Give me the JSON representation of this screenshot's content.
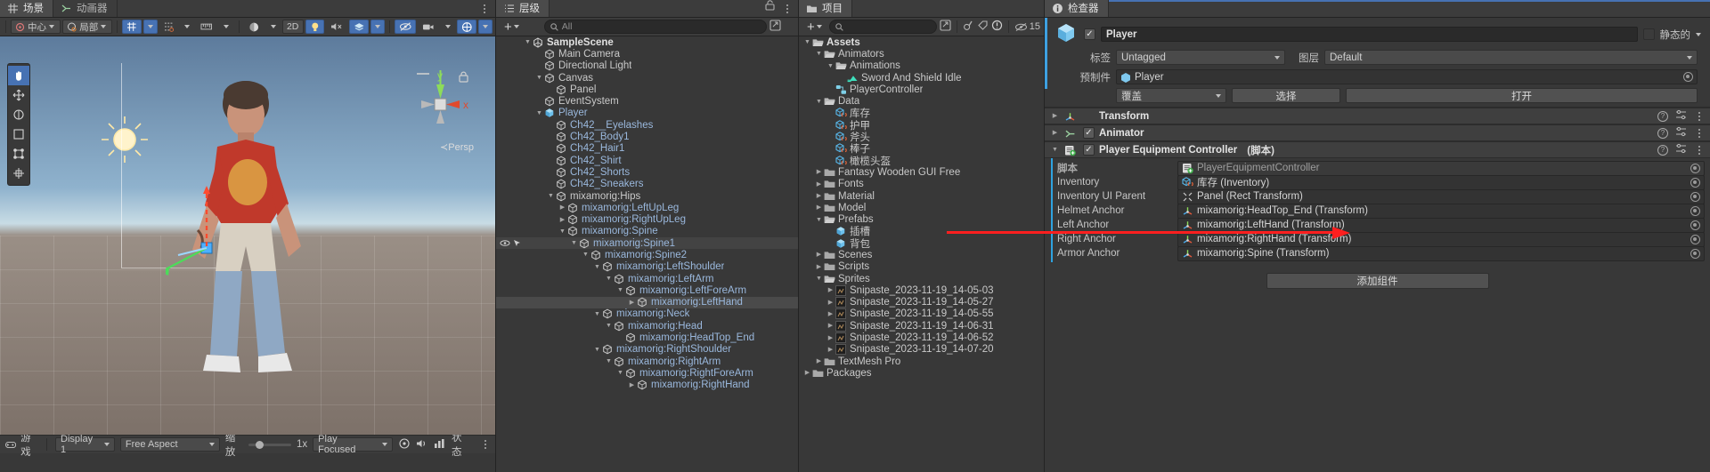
{
  "scene": {
    "tabs": [
      {
        "label": "场景",
        "icon": "grid-icon",
        "active": true
      },
      {
        "label": "动画器",
        "icon": "animator-icon",
        "active": false
      }
    ],
    "toolbar": {
      "pivot_label": "中心",
      "space_label": "局部",
      "mode_2d": "2D",
      "persp_label": "Persp",
      "axis_x": "x",
      "axis_y": "y"
    },
    "gamebar": {
      "tab_label": "游戏",
      "display": "Display 1",
      "aspect": "Free Aspect",
      "scale_label": "缩放",
      "scale_value": "1x",
      "play_focused": "Play Focused",
      "stats_label": "状态"
    }
  },
  "hierarchy": {
    "tab_label": "层级",
    "search_placeholder": "All",
    "rows": [
      {
        "label": "SampleScene",
        "depth": 0,
        "arrow": "down",
        "icon": "unity-icon",
        "style": "bold"
      },
      {
        "label": "Main Camera",
        "depth": 1,
        "arrow": "none",
        "icon": "gameobject-icon",
        "style": "normal"
      },
      {
        "label": "Directional Light",
        "depth": 1,
        "arrow": "none",
        "icon": "gameobject-icon",
        "style": "normal"
      },
      {
        "label": "Canvas",
        "depth": 1,
        "arrow": "down",
        "icon": "gameobject-icon",
        "style": "normal"
      },
      {
        "label": "Panel",
        "depth": 2,
        "arrow": "none",
        "icon": "gameobject-icon",
        "style": "normal"
      },
      {
        "label": "EventSystem",
        "depth": 1,
        "arrow": "none",
        "icon": "gameobject-icon",
        "style": "normal"
      },
      {
        "label": "Player",
        "depth": 1,
        "arrow": "down",
        "icon": "prefab-icon",
        "style": "blue"
      },
      {
        "label": "Ch42__Eyelashes",
        "depth": 2,
        "arrow": "none",
        "icon": "gameobject-icon",
        "style": "blue"
      },
      {
        "label": "Ch42_Body1",
        "depth": 2,
        "arrow": "none",
        "icon": "gameobject-icon",
        "style": "blue"
      },
      {
        "label": "Ch42_Hair1",
        "depth": 2,
        "arrow": "none",
        "icon": "gameobject-icon",
        "style": "blue"
      },
      {
        "label": "Ch42_Shirt",
        "depth": 2,
        "arrow": "none",
        "icon": "gameobject-icon",
        "style": "blue"
      },
      {
        "label": "Ch42_Shorts",
        "depth": 2,
        "arrow": "none",
        "icon": "gameobject-icon",
        "style": "blue"
      },
      {
        "label": "Ch42_Sneakers",
        "depth": 2,
        "arrow": "none",
        "icon": "gameobject-icon",
        "style": "blue"
      },
      {
        "label": "mixamorig:Hips",
        "depth": 2,
        "arrow": "down",
        "icon": "gameobject-icon",
        "style": "normal"
      },
      {
        "label": "mixamorig:LeftUpLeg",
        "depth": 3,
        "arrow": "right",
        "icon": "gameobject-icon",
        "style": "blue"
      },
      {
        "label": "mixamorig:RightUpLeg",
        "depth": 3,
        "arrow": "right",
        "icon": "gameobject-icon",
        "style": "blue"
      },
      {
        "label": "mixamorig:Spine",
        "depth": 3,
        "arrow": "down",
        "icon": "gameobject-icon",
        "style": "blue"
      },
      {
        "label": "mixamorig:Spine1",
        "depth": 4,
        "arrow": "down",
        "icon": "gameobject-icon",
        "style": "blue",
        "hover": true
      },
      {
        "label": "mixamorig:Spine2",
        "depth": 5,
        "arrow": "down",
        "icon": "gameobject-icon",
        "style": "blue"
      },
      {
        "label": "mixamorig:LeftShoulder",
        "depth": 6,
        "arrow": "down",
        "icon": "gameobject-icon",
        "style": "blue"
      },
      {
        "label": "mixamorig:LeftArm",
        "depth": 7,
        "arrow": "down",
        "icon": "gameobject-icon",
        "style": "blue"
      },
      {
        "label": "mixamorig:LeftForeArm",
        "depth": 8,
        "arrow": "down",
        "icon": "gameobject-icon",
        "style": "blue"
      },
      {
        "label": "mixamorig:LeftHand",
        "depth": 9,
        "arrow": "right",
        "icon": "gameobject-icon",
        "style": "blue",
        "selected": true
      },
      {
        "label": "mixamorig:Neck",
        "depth": 6,
        "arrow": "down",
        "icon": "gameobject-icon",
        "style": "blue"
      },
      {
        "label": "mixamorig:Head",
        "depth": 7,
        "arrow": "down",
        "icon": "gameobject-icon",
        "style": "blue"
      },
      {
        "label": "mixamorig:HeadTop_End",
        "depth": 8,
        "arrow": "none",
        "icon": "gameobject-icon",
        "style": "blue"
      },
      {
        "label": "mixamorig:RightShoulder",
        "depth": 6,
        "arrow": "down",
        "icon": "gameobject-icon",
        "style": "blue"
      },
      {
        "label": "mixamorig:RightArm",
        "depth": 7,
        "arrow": "down",
        "icon": "gameobject-icon",
        "style": "blue"
      },
      {
        "label": "mixamorig:RightForeArm",
        "depth": 8,
        "arrow": "down",
        "icon": "gameobject-icon",
        "style": "blue"
      },
      {
        "label": "mixamorig:RightHand",
        "depth": 9,
        "arrow": "right",
        "icon": "gameobject-icon",
        "style": "blue"
      }
    ]
  },
  "project": {
    "tab_label": "项目",
    "search_placeholder": "",
    "count_badge": "15",
    "rows": [
      {
        "label": "Assets",
        "depth": 0,
        "arrow": "down",
        "icon": "folder-open-icon",
        "style": "bold"
      },
      {
        "label": "Animators",
        "depth": 1,
        "arrow": "down",
        "icon": "folder-open-icon",
        "style": "normal"
      },
      {
        "label": "Animations",
        "depth": 2,
        "arrow": "down",
        "icon": "folder-open-icon",
        "style": "normal"
      },
      {
        "label": "Sword And Shield Idle",
        "depth": 3,
        "arrow": "none",
        "icon": "animation-clip-icon",
        "style": "normal"
      },
      {
        "label": "PlayerController",
        "depth": 2,
        "arrow": "none",
        "icon": "animator-controller-icon",
        "style": "normal"
      },
      {
        "label": "Data",
        "depth": 1,
        "arrow": "down",
        "icon": "folder-open-icon",
        "style": "normal"
      },
      {
        "label": "库存",
        "depth": 2,
        "arrow": "none",
        "icon": "scriptable-object-icon",
        "style": "normal"
      },
      {
        "label": "护甲",
        "depth": 2,
        "arrow": "none",
        "icon": "scriptable-object-icon",
        "style": "normal"
      },
      {
        "label": "斧头",
        "depth": 2,
        "arrow": "none",
        "icon": "scriptable-object-icon",
        "style": "normal"
      },
      {
        "label": "棒子",
        "depth": 2,
        "arrow": "none",
        "icon": "scriptable-object-icon",
        "style": "normal"
      },
      {
        "label": "橄榄头盔",
        "depth": 2,
        "arrow": "none",
        "icon": "scriptable-object-icon",
        "style": "normal"
      },
      {
        "label": "Fantasy Wooden GUI  Free",
        "depth": 1,
        "arrow": "right",
        "icon": "folder-icon",
        "style": "normal"
      },
      {
        "label": "Fonts",
        "depth": 1,
        "arrow": "right",
        "icon": "folder-icon",
        "style": "normal"
      },
      {
        "label": "Material",
        "depth": 1,
        "arrow": "right",
        "icon": "folder-icon",
        "style": "normal"
      },
      {
        "label": "Model",
        "depth": 1,
        "arrow": "right",
        "icon": "folder-icon",
        "style": "normal"
      },
      {
        "label": "Prefabs",
        "depth": 1,
        "arrow": "down",
        "icon": "folder-open-icon",
        "style": "normal"
      },
      {
        "label": "插槽",
        "depth": 2,
        "arrow": "none",
        "icon": "prefab-icon",
        "style": "normal"
      },
      {
        "label": "背包",
        "depth": 2,
        "arrow": "none",
        "icon": "prefab-icon",
        "style": "normal"
      },
      {
        "label": "Scenes",
        "depth": 1,
        "arrow": "right",
        "icon": "folder-icon",
        "style": "normal"
      },
      {
        "label": "Scripts",
        "depth": 1,
        "arrow": "right",
        "icon": "folder-icon",
        "style": "normal"
      },
      {
        "label": "Sprites",
        "depth": 1,
        "arrow": "down",
        "icon": "folder-open-icon",
        "style": "normal"
      },
      {
        "label": "Snipaste_2023-11-19_14-05-03",
        "depth": 2,
        "arrow": "right",
        "icon": "texture-icon",
        "style": "normal"
      },
      {
        "label": "Snipaste_2023-11-19_14-05-27",
        "depth": 2,
        "arrow": "right",
        "icon": "texture-icon",
        "style": "normal"
      },
      {
        "label": "Snipaste_2023-11-19_14-05-55",
        "depth": 2,
        "arrow": "right",
        "icon": "texture-icon",
        "style": "normal"
      },
      {
        "label": "Snipaste_2023-11-19_14-06-31",
        "depth": 2,
        "arrow": "right",
        "icon": "texture-icon",
        "style": "normal"
      },
      {
        "label": "Snipaste_2023-11-19_14-06-52",
        "depth": 2,
        "arrow": "right",
        "icon": "texture-icon",
        "style": "normal"
      },
      {
        "label": "Snipaste_2023-11-19_14-07-20",
        "depth": 2,
        "arrow": "right",
        "icon": "texture-icon",
        "style": "normal"
      },
      {
        "label": "TextMesh Pro",
        "depth": 1,
        "arrow": "right",
        "icon": "folder-icon",
        "style": "normal"
      },
      {
        "label": "Packages",
        "depth": 0,
        "arrow": "right",
        "icon": "folder-icon",
        "style": "normal"
      }
    ]
  },
  "inspector": {
    "tab_label": "检查器",
    "object_name": "Player",
    "static_label": "静态的",
    "tag_label": "标签",
    "tag_value": "Untagged",
    "layer_label": "图层",
    "layer_value": "Default",
    "prefab_label": "预制件",
    "prefab_value": "Player",
    "overrides_label": "覆盖",
    "select_label": "选择",
    "open_label": "打开",
    "components": [
      {
        "title": "Transform",
        "suffix": "",
        "icon": "transform-icon",
        "has_checkbox": false,
        "expanded": false
      },
      {
        "title": "Animator",
        "suffix": "",
        "icon": "animator-icon",
        "has_checkbox": true,
        "expanded": false
      },
      {
        "title": "Player Equipment Controller",
        "suffix": "(脚本)",
        "icon": "script-icon",
        "has_checkbox": true,
        "expanded": true
      }
    ],
    "properties": [
      {
        "label": "脚本",
        "value": "PlayerEquipmentController",
        "icon": "script-icon",
        "dim": true
      },
      {
        "label": "Inventory",
        "value": "库存 (Inventory)",
        "icon": "scriptable-object-icon",
        "dim": false
      },
      {
        "label": "Inventory UI Parent",
        "value": "Panel (Rect Transform)",
        "icon": "rect-transform-icon",
        "dim": false
      },
      {
        "label": "Helmet Anchor",
        "value": "mixamorig:HeadTop_End (Transform)",
        "icon": "transform-icon",
        "dim": false
      },
      {
        "label": "Left Anchor",
        "value": "mixamorig:LeftHand (Transform)",
        "icon": "transform-icon",
        "dim": false
      },
      {
        "label": "Right Anchor",
        "value": "mixamorig:RightHand (Transform)",
        "icon": "transform-icon",
        "dim": false
      },
      {
        "label": "Armor Anchor",
        "value": "mixamorig:Spine (Transform)",
        "icon": "transform-icon",
        "dim": false
      }
    ],
    "add_component_label": "添加组件"
  },
  "colors": {
    "accent_blue": "#4772b3",
    "annotation_red": "#ff1f1f",
    "prefab_blue": "#9ab8dd",
    "panel_bg": "#383838",
    "header_bg": "#3c3c3c"
  }
}
